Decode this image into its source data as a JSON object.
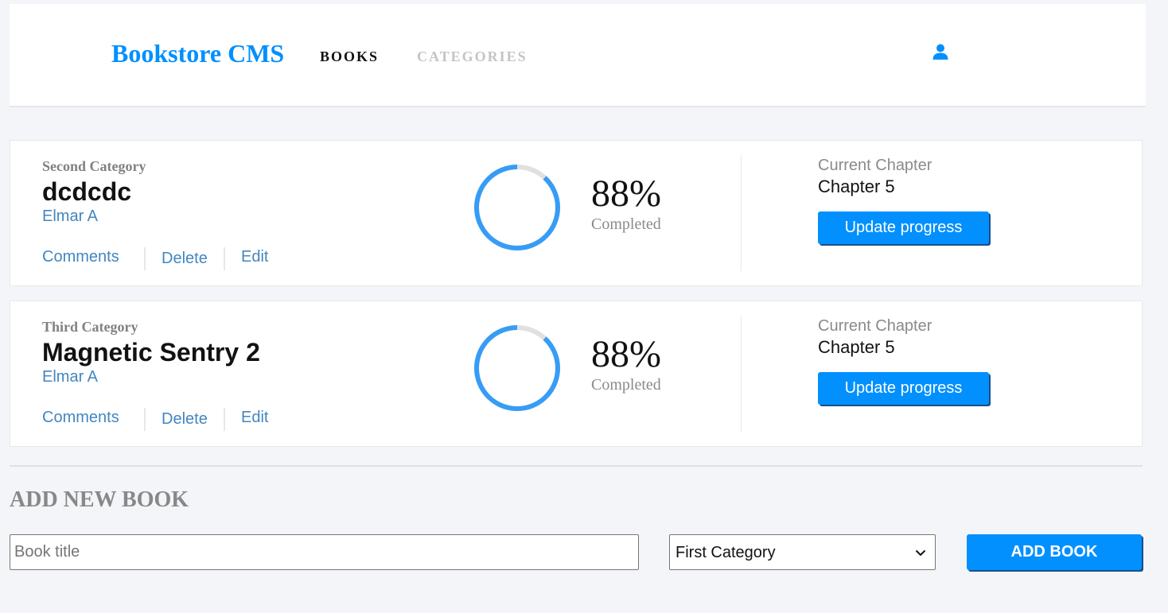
{
  "header": {
    "logo": "Bookstore CMS",
    "nav": {
      "books": "BOOKS",
      "categories": "CATEGORIES"
    },
    "user_icon": "user-icon"
  },
  "books": [
    {
      "category": "Second Category",
      "title": "dcdcdc",
      "author": "Elmar A",
      "actions": {
        "comments": "Comments",
        "delete": "Delete",
        "edit": "Edit"
      },
      "progress_percent": 88,
      "progress_label": "88%",
      "completed_label": "Completed",
      "current_chapter_label": "Current Chapter",
      "current_chapter": "Chapter 5",
      "update_button": "Update progress"
    },
    {
      "category": "Third Category",
      "title": "Magnetic Sentry 2",
      "author": "Elmar A",
      "actions": {
        "comments": "Comments",
        "delete": "Delete",
        "edit": "Edit"
      },
      "progress_percent": 88,
      "progress_label": "88%",
      "completed_label": "Completed",
      "current_chapter_label": "Current Chapter",
      "current_chapter": "Chapter 5",
      "update_button": "Update progress"
    }
  ],
  "form": {
    "heading": "ADD NEW BOOK",
    "title_placeholder": "Book title",
    "title_value": "",
    "category_selected": "First Category",
    "submit": "ADD BOOK"
  },
  "colors": {
    "accent": "#0290ff",
    "link": "#4386bf",
    "ring_track": "#e0e0e0",
    "ring_fill": "#379cf6"
  }
}
